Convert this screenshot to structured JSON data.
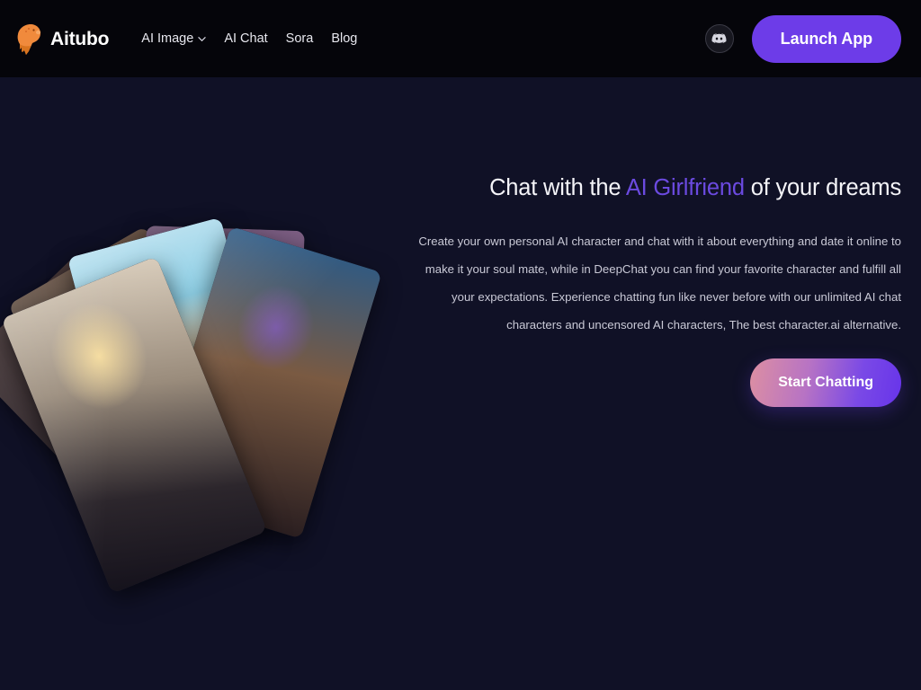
{
  "theme": {
    "header_bg": "#05050a",
    "page_bg": "#101126",
    "accent_purple": "#6b4ae0",
    "button_purple": "#6d3ce8",
    "gradient_start": "#dd8fa2",
    "gradient_end": "#6734ea",
    "logo_orange": "#f08a3c"
  },
  "header": {
    "brand": {
      "name": "Aitubo",
      "logo_icon": "capybara-mascot-icon"
    },
    "nav": [
      {
        "label": "AI Image",
        "has_dropdown": true,
        "dropdown_icon": "chevron-down-icon"
      },
      {
        "label": "AI Chat",
        "has_dropdown": false
      },
      {
        "label": "Sora",
        "has_dropdown": false
      },
      {
        "label": "Blog",
        "has_dropdown": false
      }
    ],
    "discord": {
      "icon": "discord-icon",
      "label": "Discord"
    },
    "launch_app_label": "Launch App"
  },
  "hero": {
    "headline": {
      "before": "Chat with the ",
      "accent": "AI Girlfriend",
      "after": " of your dreams"
    },
    "paragraph": "Create your own personal AI character and chat with it about everything and date it online to make it your soul mate, while in DeepChat you can find your favorite character and fulfill all your expectations. Experience chatting fun like never before with our unlimited AI chat characters and uncensored AI characters, The best character.ai alternative.",
    "cta_label": "Start Chatting",
    "collage": {
      "name": "ai-character-card-fan",
      "cards": [
        {
          "id": 1,
          "rotation_deg": -44,
          "art": "art-a",
          "alt": "anime character card"
        },
        {
          "id": 2,
          "rotation_deg": -30,
          "art": "art-b",
          "alt": "pink haired anime character card"
        },
        {
          "id": 3,
          "rotation_deg": -15,
          "art": "art-c",
          "alt": "beach scene anime character card"
        },
        {
          "id": 4,
          "rotation_deg": 2,
          "art": "art-d",
          "alt": "purple haired anime character card"
        },
        {
          "id": 5,
          "rotation_deg": 17,
          "art": "art-e",
          "alt": "street scene anime character card"
        },
        {
          "id": 6,
          "rotation_deg": -22,
          "art": "art-f",
          "alt": "blonde schoolgirl anime character card"
        }
      ]
    }
  }
}
